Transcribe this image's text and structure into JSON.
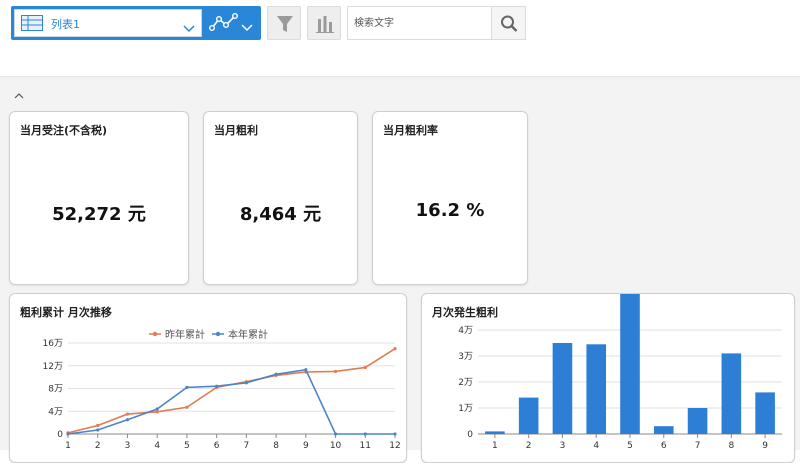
{
  "toolbar": {
    "view_label": "列表1",
    "search_placeholder": "検索文字"
  },
  "kpis": [
    {
      "title": "当月受注(不含税)",
      "value": "52,272 元"
    },
    {
      "title": "当月粗利",
      "value": "8,464 元"
    },
    {
      "title": "当月粗利率",
      "value": "16.2 %"
    }
  ],
  "colors": {
    "accent": "#2a86d6",
    "series_last_year": "#e07c52",
    "series_this_year": "#4a86c6",
    "bar": "#2d7fd6"
  },
  "charts": {
    "line": {
      "title": "粗利累计 月次推移"
    },
    "bar": {
      "title": "月次発生粗利"
    }
  },
  "chart_data": [
    {
      "type": "line",
      "title": "粗利累计 月次推移",
      "x": [
        1,
        2,
        3,
        4,
        5,
        6,
        7,
        8,
        9,
        10,
        11,
        12
      ],
      "ylim": [
        0,
        160000
      ],
      "yticks": [
        0,
        40000,
        80000,
        120000,
        160000
      ],
      "ytick_labels": [
        "0",
        "4万",
        "8万",
        "12万",
        "16万"
      ],
      "legend": "top-center",
      "grid": true,
      "series": [
        {
          "name": "昨年累計",
          "color": "#e07c52",
          "values": [
            2000,
            15000,
            35000,
            39000,
            47000,
            82000,
            92000,
            103000,
            109000,
            110000,
            117000,
            150000
          ]
        },
        {
          "name": "本年累計",
          "color": "#4a86c6",
          "values": [
            0,
            7000,
            25000,
            44000,
            82000,
            84000,
            90000,
            105000,
            113000,
            0,
            0,
            0
          ]
        }
      ]
    },
    {
      "type": "bar",
      "title": "月次発生粗利",
      "categories": [
        "1",
        "2",
        "3",
        "4",
        "5",
        "6",
        "7",
        "8",
        "9"
      ],
      "values": [
        1000,
        14000,
        35000,
        34500,
        72500,
        3000,
        10000,
        31000,
        16000
      ],
      "ylim": [
        0,
        40000
      ],
      "yticks": [
        0,
        10000,
        20000,
        30000,
        40000
      ],
      "ytick_labels": [
        "0",
        "1万",
        "2万",
        "3万",
        "4万"
      ],
      "grid": true
    }
  ]
}
